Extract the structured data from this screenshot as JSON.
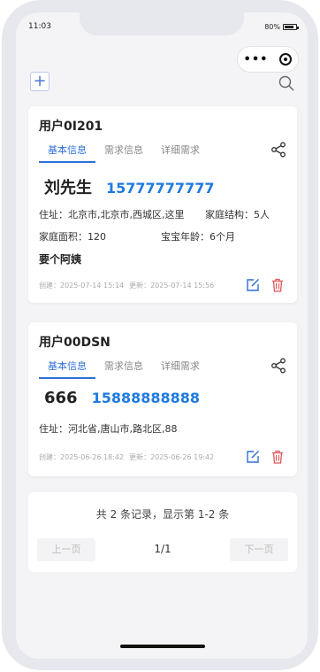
{
  "status": {
    "time": "11:03",
    "battery": "80%"
  },
  "toolbar": {
    "add_label": "+"
  },
  "records": [
    {
      "title": "用户0I201",
      "tabs": [
        "基本信息",
        "需求信息",
        "详细需求"
      ],
      "name": "刘先生",
      "phone": "15777777777",
      "address": "住址：北京市,北京市,西城区,这里",
      "family": "家庭结构：5人",
      "area": "家庭面积：120",
      "baby_age": "宝宝年龄：6个月",
      "note": "要个阿姨",
      "created": "创建：2025-07-14 15:14",
      "updated": "更新：2025-07-14 15:56"
    },
    {
      "title": "用户00DSN",
      "tabs": [
        "基本信息",
        "需求信息",
        "详细需求"
      ],
      "name": "666",
      "phone": "15888888888",
      "address": "住址：河北省,唐山市,路北区,88",
      "created": "创建：2025-06-26 18:42",
      "updated": "更新：2025-06-26 19:42"
    }
  ],
  "pagination": {
    "summary": "共 2 条记录，显示第 1-2 条",
    "prev": "上一页",
    "page": "1/1",
    "next": "下一页"
  },
  "colors": {
    "accent": "#2f6fd6",
    "phone": "#1f7ae0",
    "delete": "#e25555"
  }
}
